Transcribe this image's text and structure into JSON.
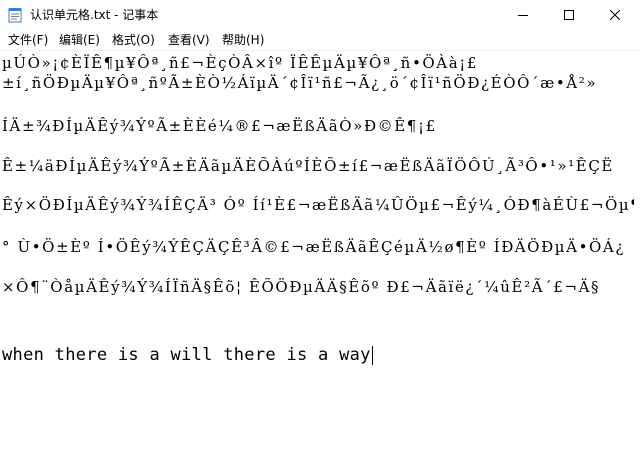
{
  "window": {
    "title": "认识单元格.txt - 记事本",
    "controls": {
      "minimize": "minimize",
      "maximize": "maximize",
      "close": "close"
    }
  },
  "menu": [
    {
      "label": "文件(F)"
    },
    {
      "label": "编辑(E)"
    },
    {
      "label": "格式(O)"
    },
    {
      "label": "查看(V)"
    },
    {
      "label": "帮助(H)"
    }
  ],
  "editor": {
    "lines": [
      "µÚÒ»¡¢ÈÏÊ¶µ¥Ôª¸ñ£¬ÈçÒÂ×îº ÏÊÊµÄµ¥Ôª¸ñ•ÖÀà¡£",
      "±í¸ñÖÐµÄµ¥Ôª¸ñºÃ±ÈÒ½ÁïµÄ´¢Îï¹ñ£¬Ã¿¸ö´¢Îï¹ñÖÐ¿ÉÒÔ´æ•Å²»",
      "ÍÄ±¾ÐÍµÄÊý¾ÝºÃ±ÈÈé¼®£¬æËßÄãÒ»Ð©Ê¶¡£",
      "Ê±¼äÐÍµÄÊý¾ÝºÃ±ÈÄãµÄÈÕÀúºÍÈÕ±í£¬æËßÄãÏÖÔÚ¸Ã³Ô•¹»¹ÊÇË",
      "Êý×ÖÐÍµÄÊý¾Ý¾ÍÊÇÄ³ Óº Íí¹È£¬æËßÄã¼ÛÖµ£¬Êý¼¸ÓÐ¶àÉÙ£¬Öµ¶àÉÙ",
      "° Ù•Ö±Èº Í•ÖÊý¾ÝÊÇÄÇÊ³Â©£¬æËßÄãÊÇéµÄ½ø¶Èº ÍÐÄÖÐµÄ•ÖÁ¿",
      "×Ô¶¨ÒåµÄÊý¾Ý¾ÍÏñÄ§Êõ¦ ÊÕÖÐµÄÄ§Êõº Ð£¬Äãïë¿´¼ûÊ²Ã´£¬Ä§"
    ],
    "text_line": "when there is a will there is a way"
  }
}
